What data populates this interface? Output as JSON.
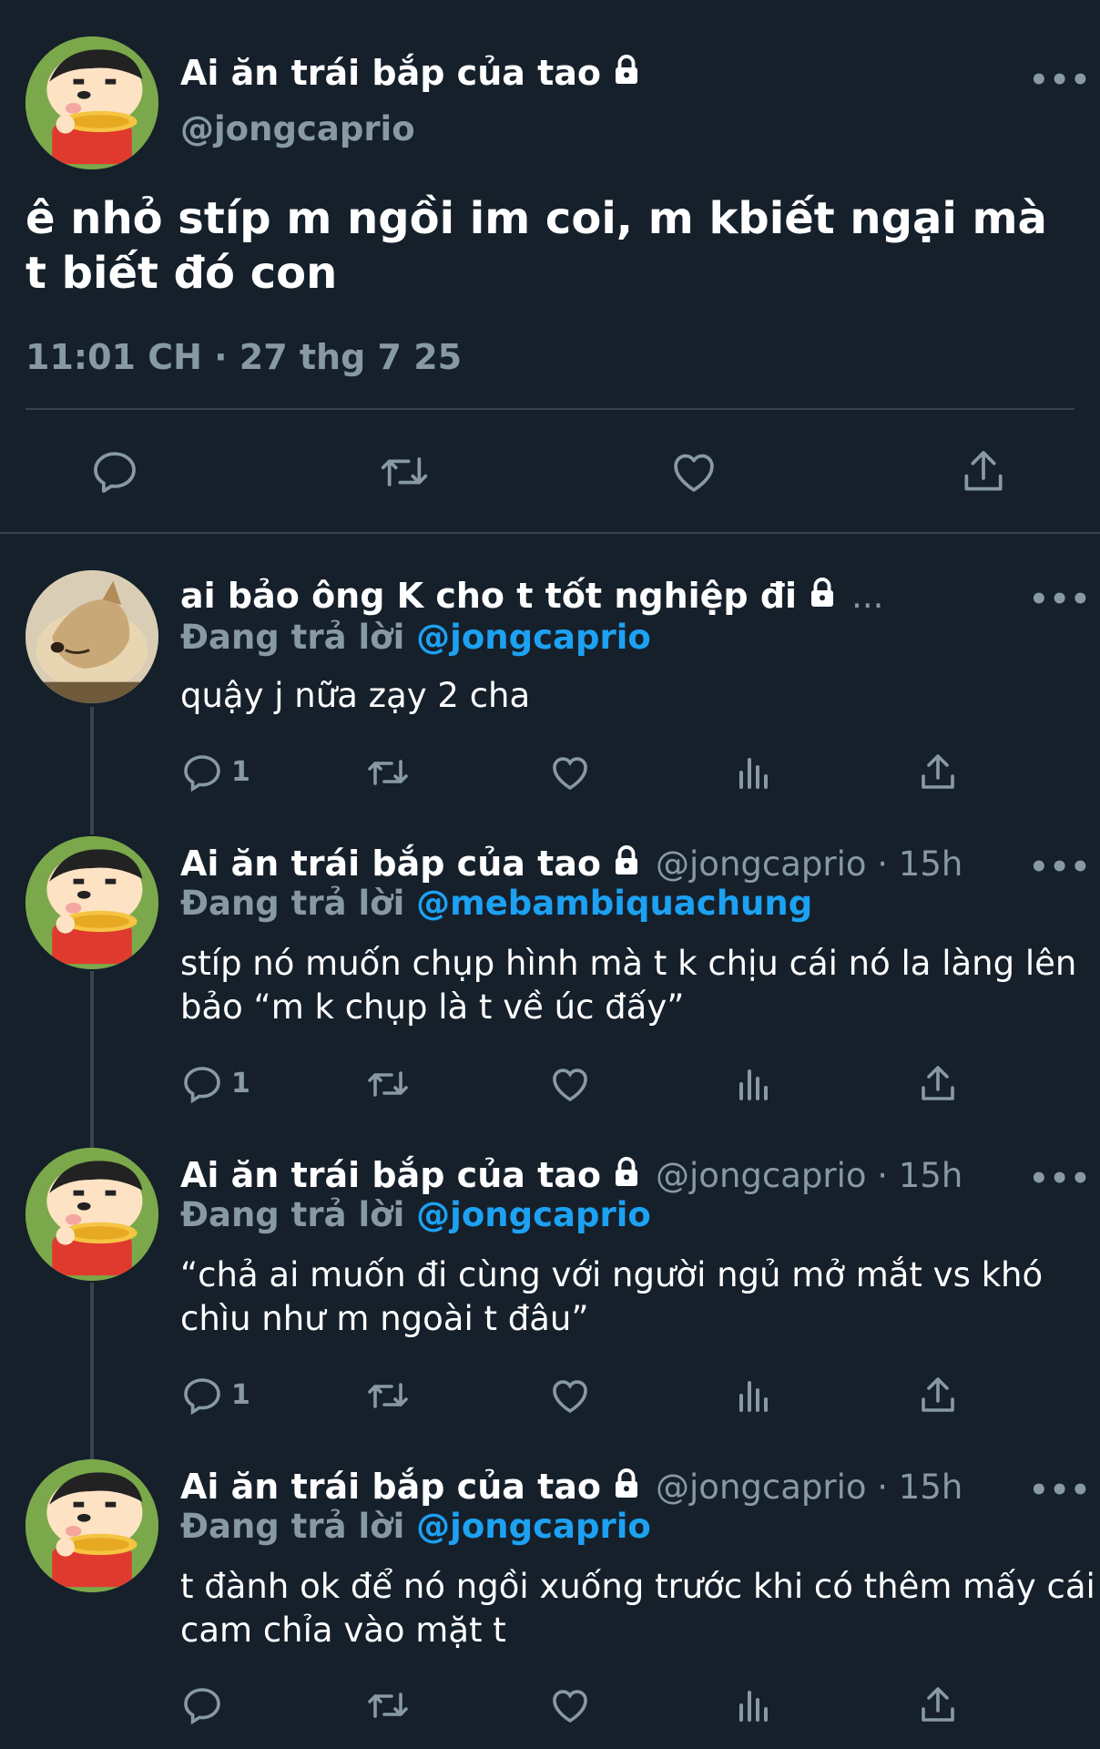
{
  "main_tweet": {
    "name": "Ai ăn trái bắp của tao",
    "handle": "@jongcaprio",
    "text": "ê nhỏ stíp m ngồi im coi, m kbiết ngại mà t biết đó con",
    "timestamp": "11:01 CH · 27 thg 7 25",
    "more_label": "•••",
    "avatar": "shinchan-avatar",
    "actions": [
      "reply-icon",
      "retweet-icon",
      "like-icon",
      "share-icon"
    ]
  },
  "replies": [
    {
      "name": "ai bảo ông K cho t tốt nghiệp đi",
      "name_suffix": "...",
      "meta": "",
      "replying_label": "Đang trả lời",
      "replying_to": "@jongcaprio",
      "text": "quậy j nữa zạy 2 cha",
      "reply_count": "1",
      "avatar": "dog-avatar",
      "more_label": "•••"
    },
    {
      "name": "Ai ăn trái bắp của tao",
      "name_suffix": "",
      "meta": "@jongcaprio · 15h",
      "replying_label": "Đang trả lời",
      "replying_to": "@mebambiquachung",
      "text": "stíp nó muốn chụp hình mà t k chịu cái nó la làng lên bảo “m k chụp là t về úc đấy”",
      "reply_count": "1",
      "avatar": "shinchan-avatar",
      "more_label": "•••"
    },
    {
      "name": "Ai ăn trái bắp của tao",
      "name_suffix": "",
      "meta": "@jongcaprio · 15h",
      "replying_label": "Đang trả lời",
      "replying_to": "@jongcaprio",
      "text": "“chả ai muốn đi cùng với người ngủ mở mắt vs khó chìu như m ngoài t đâu”",
      "reply_count": "1",
      "avatar": "shinchan-avatar",
      "more_label": "•••"
    },
    {
      "name": "Ai ăn trái bắp của tao",
      "name_suffix": "",
      "meta": "@jongcaprio · 15h",
      "replying_label": "Đang trả lời",
      "replying_to": "@jongcaprio",
      "text": "t đành ok để nó ngồi xuống trước khi có thêm mấy cái cam chỉa vào mặt t",
      "reply_count": "",
      "avatar": "shinchan-avatar",
      "more_label": "•••"
    }
  ],
  "colors": {
    "background": "#15202b",
    "text_primary": "#ffffff",
    "text_secondary": "#8899a6",
    "mention": "#1da1f2",
    "divider": "#38444d"
  }
}
